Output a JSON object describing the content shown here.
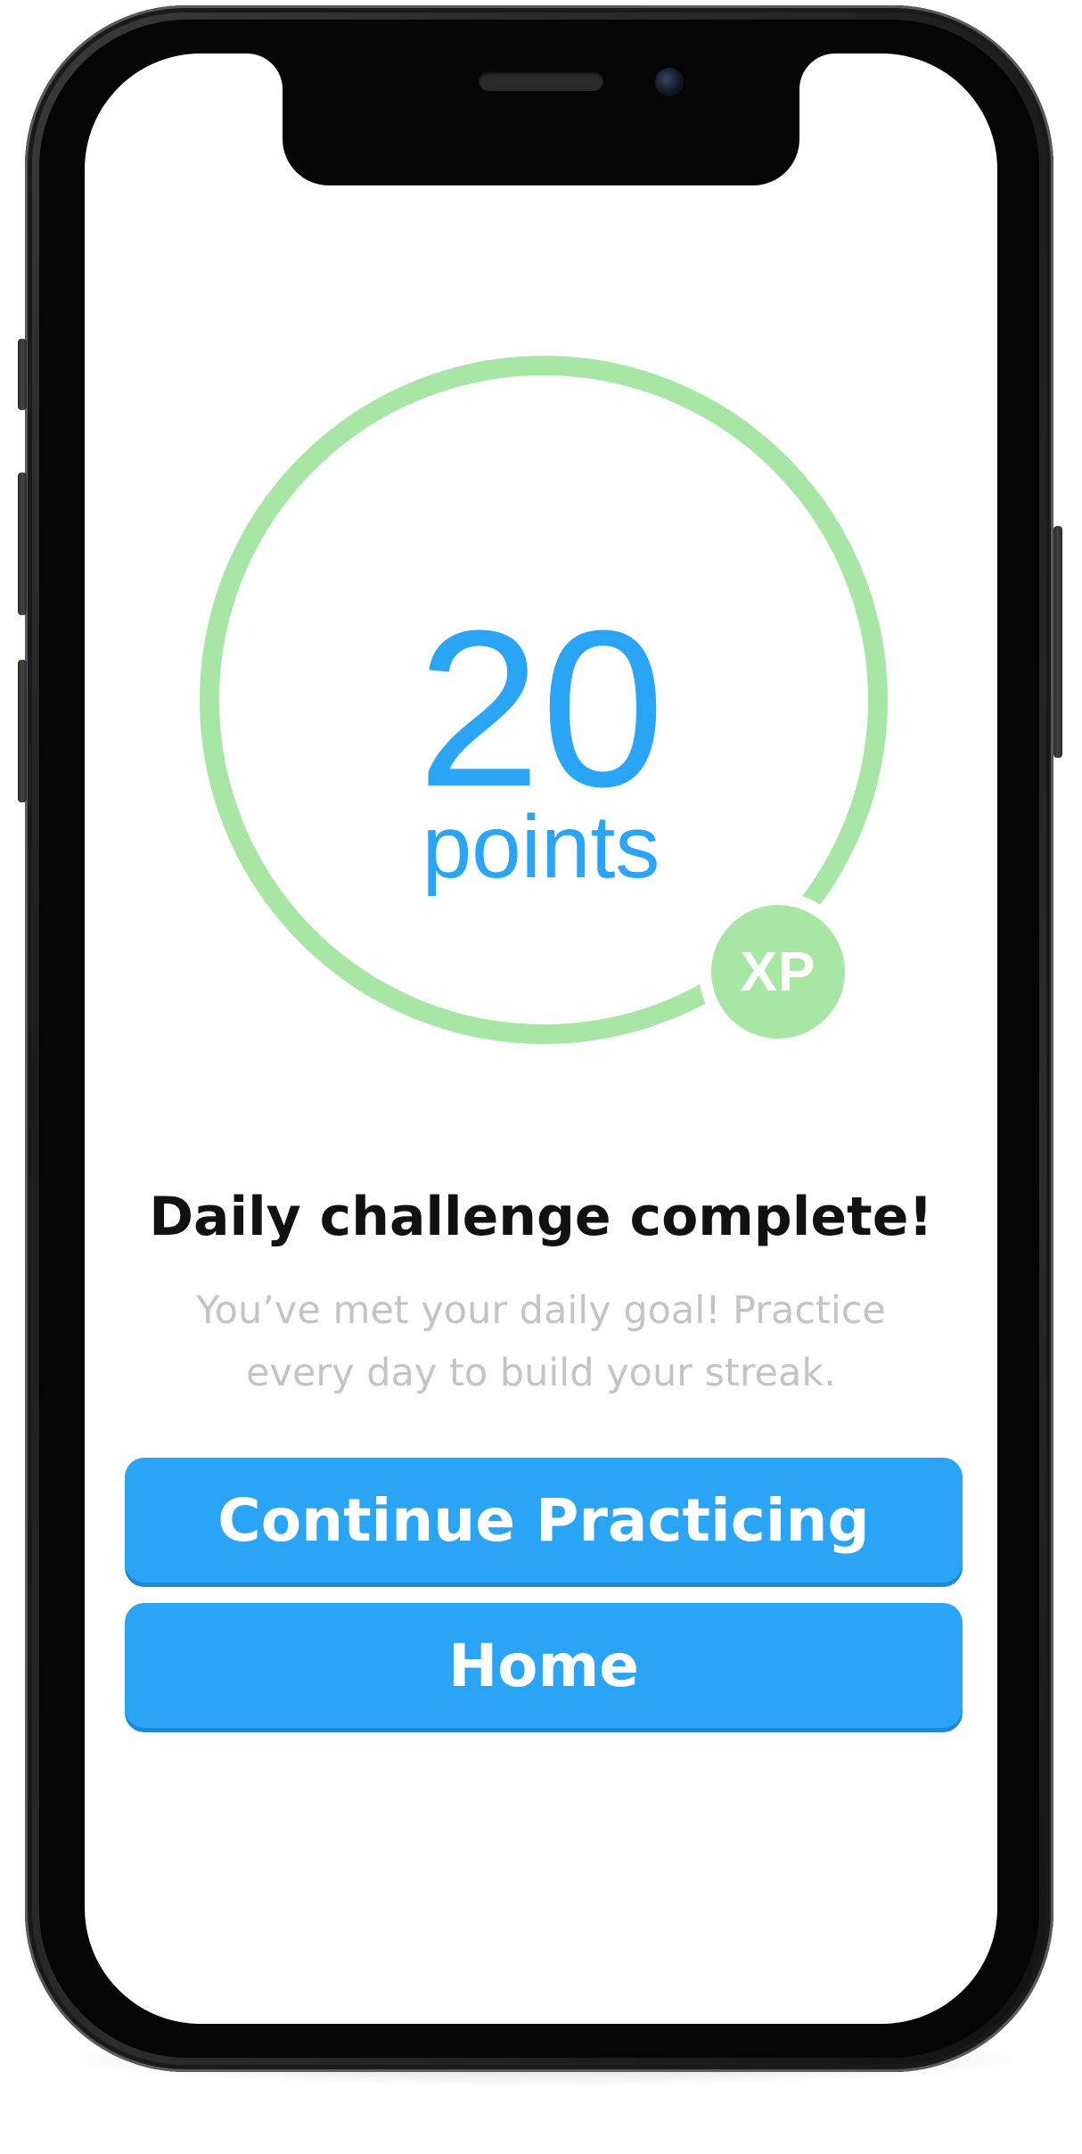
{
  "progress": {
    "value": 20,
    "unit_label": "points",
    "badge": "XP",
    "ring_fill_fraction": 0.9,
    "ring_color": "#a8e6a6",
    "value_color": "#2aa4f4"
  },
  "message": {
    "title": "Daily challenge complete!",
    "subtitle": "You’ve met your daily goal! Practice every day to build your streak."
  },
  "actions": {
    "continue_label": "Continue Practicing",
    "home_label": "Home",
    "button_color": "#2aa4f4"
  }
}
